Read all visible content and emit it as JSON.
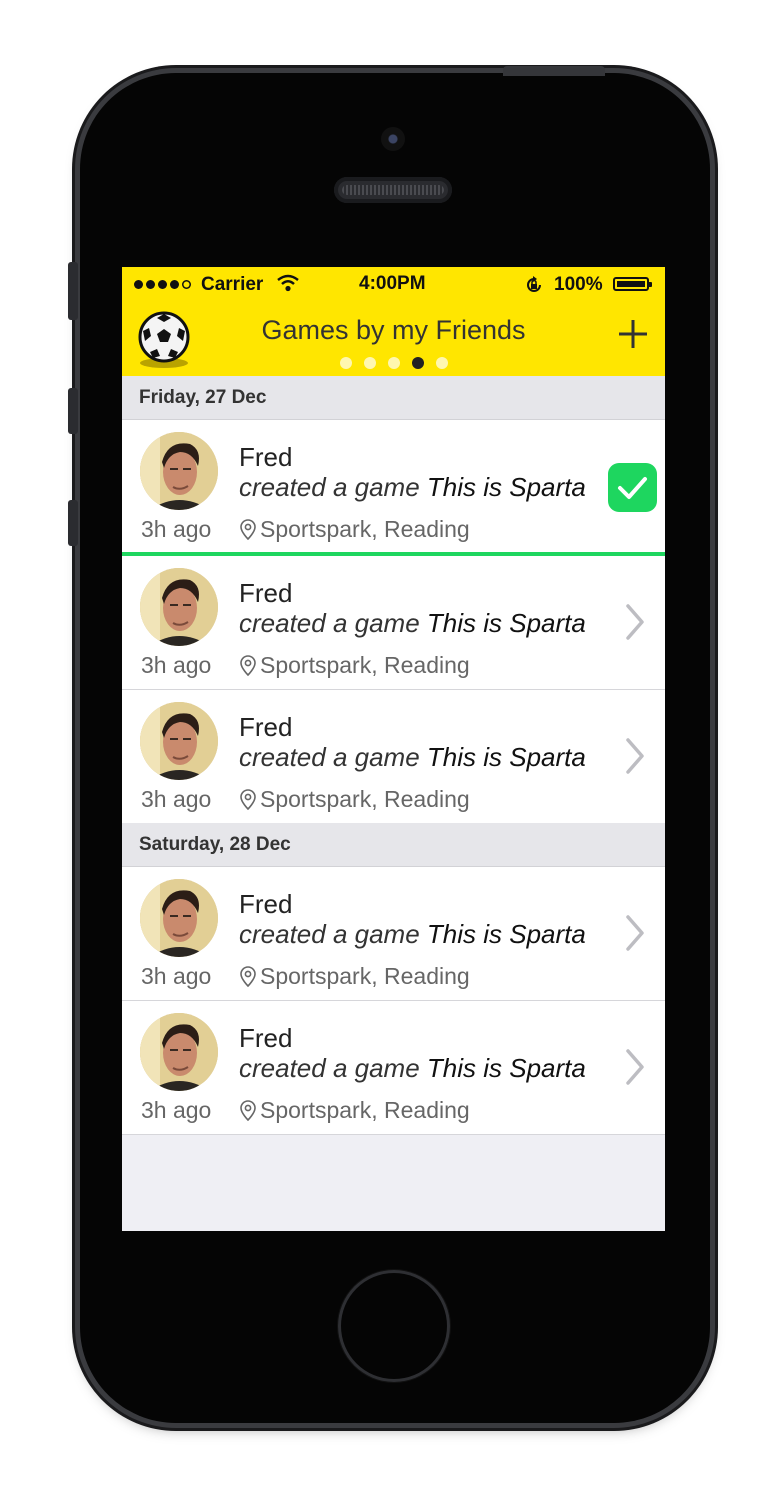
{
  "status_bar": {
    "carrier": "Carrier",
    "time": "4:00PM",
    "battery": "100%"
  },
  "nav": {
    "title": "Games by my Friends",
    "page_count": 5,
    "active_page": 4
  },
  "colors": {
    "nav_background": "#ffe600",
    "accent_green": "#1ed65f"
  },
  "sections": [
    {
      "header": "Friday, 27 Dec",
      "items": [
        {
          "name": "Fred",
          "action": "created a game ",
          "game": "This is Sparta",
          "time": "3h ago",
          "location": "Sportspark, Reading",
          "state": "selected"
        },
        {
          "name": "Fred",
          "action": "created a game ",
          "game": "This is Sparta",
          "time": "3h ago",
          "location": "Sportspark, Reading",
          "state": "default"
        },
        {
          "name": "Fred",
          "action": "created a game ",
          "game": "This is Sparta",
          "time": "3h ago",
          "location": "Sportspark, Reading",
          "state": "default"
        }
      ]
    },
    {
      "header": "Saturday, 28 Dec",
      "items": [
        {
          "name": "Fred",
          "action": "created a game ",
          "game": "This is Sparta",
          "time": "3h ago",
          "location": "Sportspark, Reading",
          "state": "default"
        },
        {
          "name": "Fred",
          "action": "created a game ",
          "game": "This is Sparta",
          "time": "3h ago",
          "location": "Sportspark, Reading",
          "state": "default"
        }
      ]
    }
  ]
}
